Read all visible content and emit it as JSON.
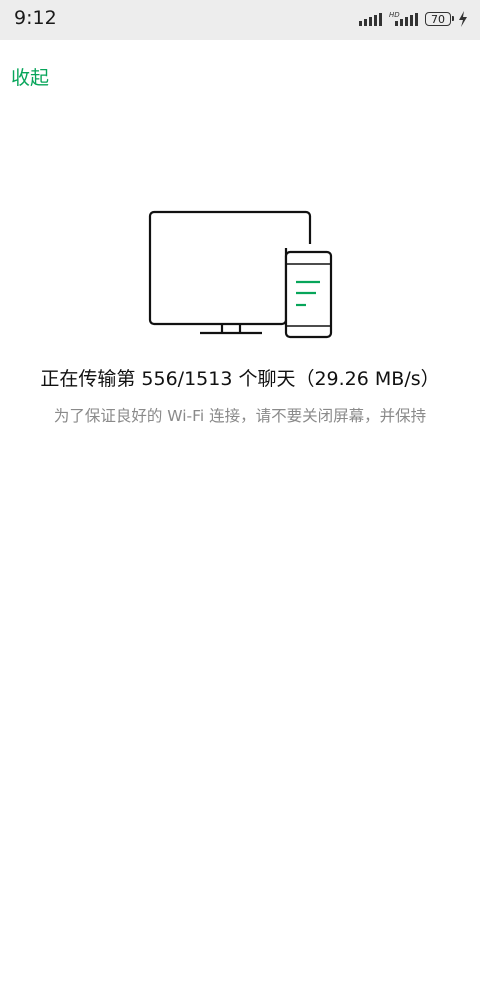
{
  "status_bar": {
    "time": "9:12",
    "battery_level": "70",
    "signal_label_2": "HD"
  },
  "header": {
    "collapse_label": "收起"
  },
  "transfer": {
    "status_text": "正在传输第 556/1513 个聊天（29.26 MB/s）",
    "hint_text": "为了保证良好的 Wi-Fi 连接，请不要关闭屏幕，并保持",
    "current": 556,
    "total": 1513,
    "speed": "29.26 MB/s"
  },
  "colors": {
    "accent": "#07a55a",
    "status_bar_bg": "#ededed"
  },
  "icons": {
    "illustration": "monitor-phone-icon",
    "charging": "bolt-icon"
  }
}
